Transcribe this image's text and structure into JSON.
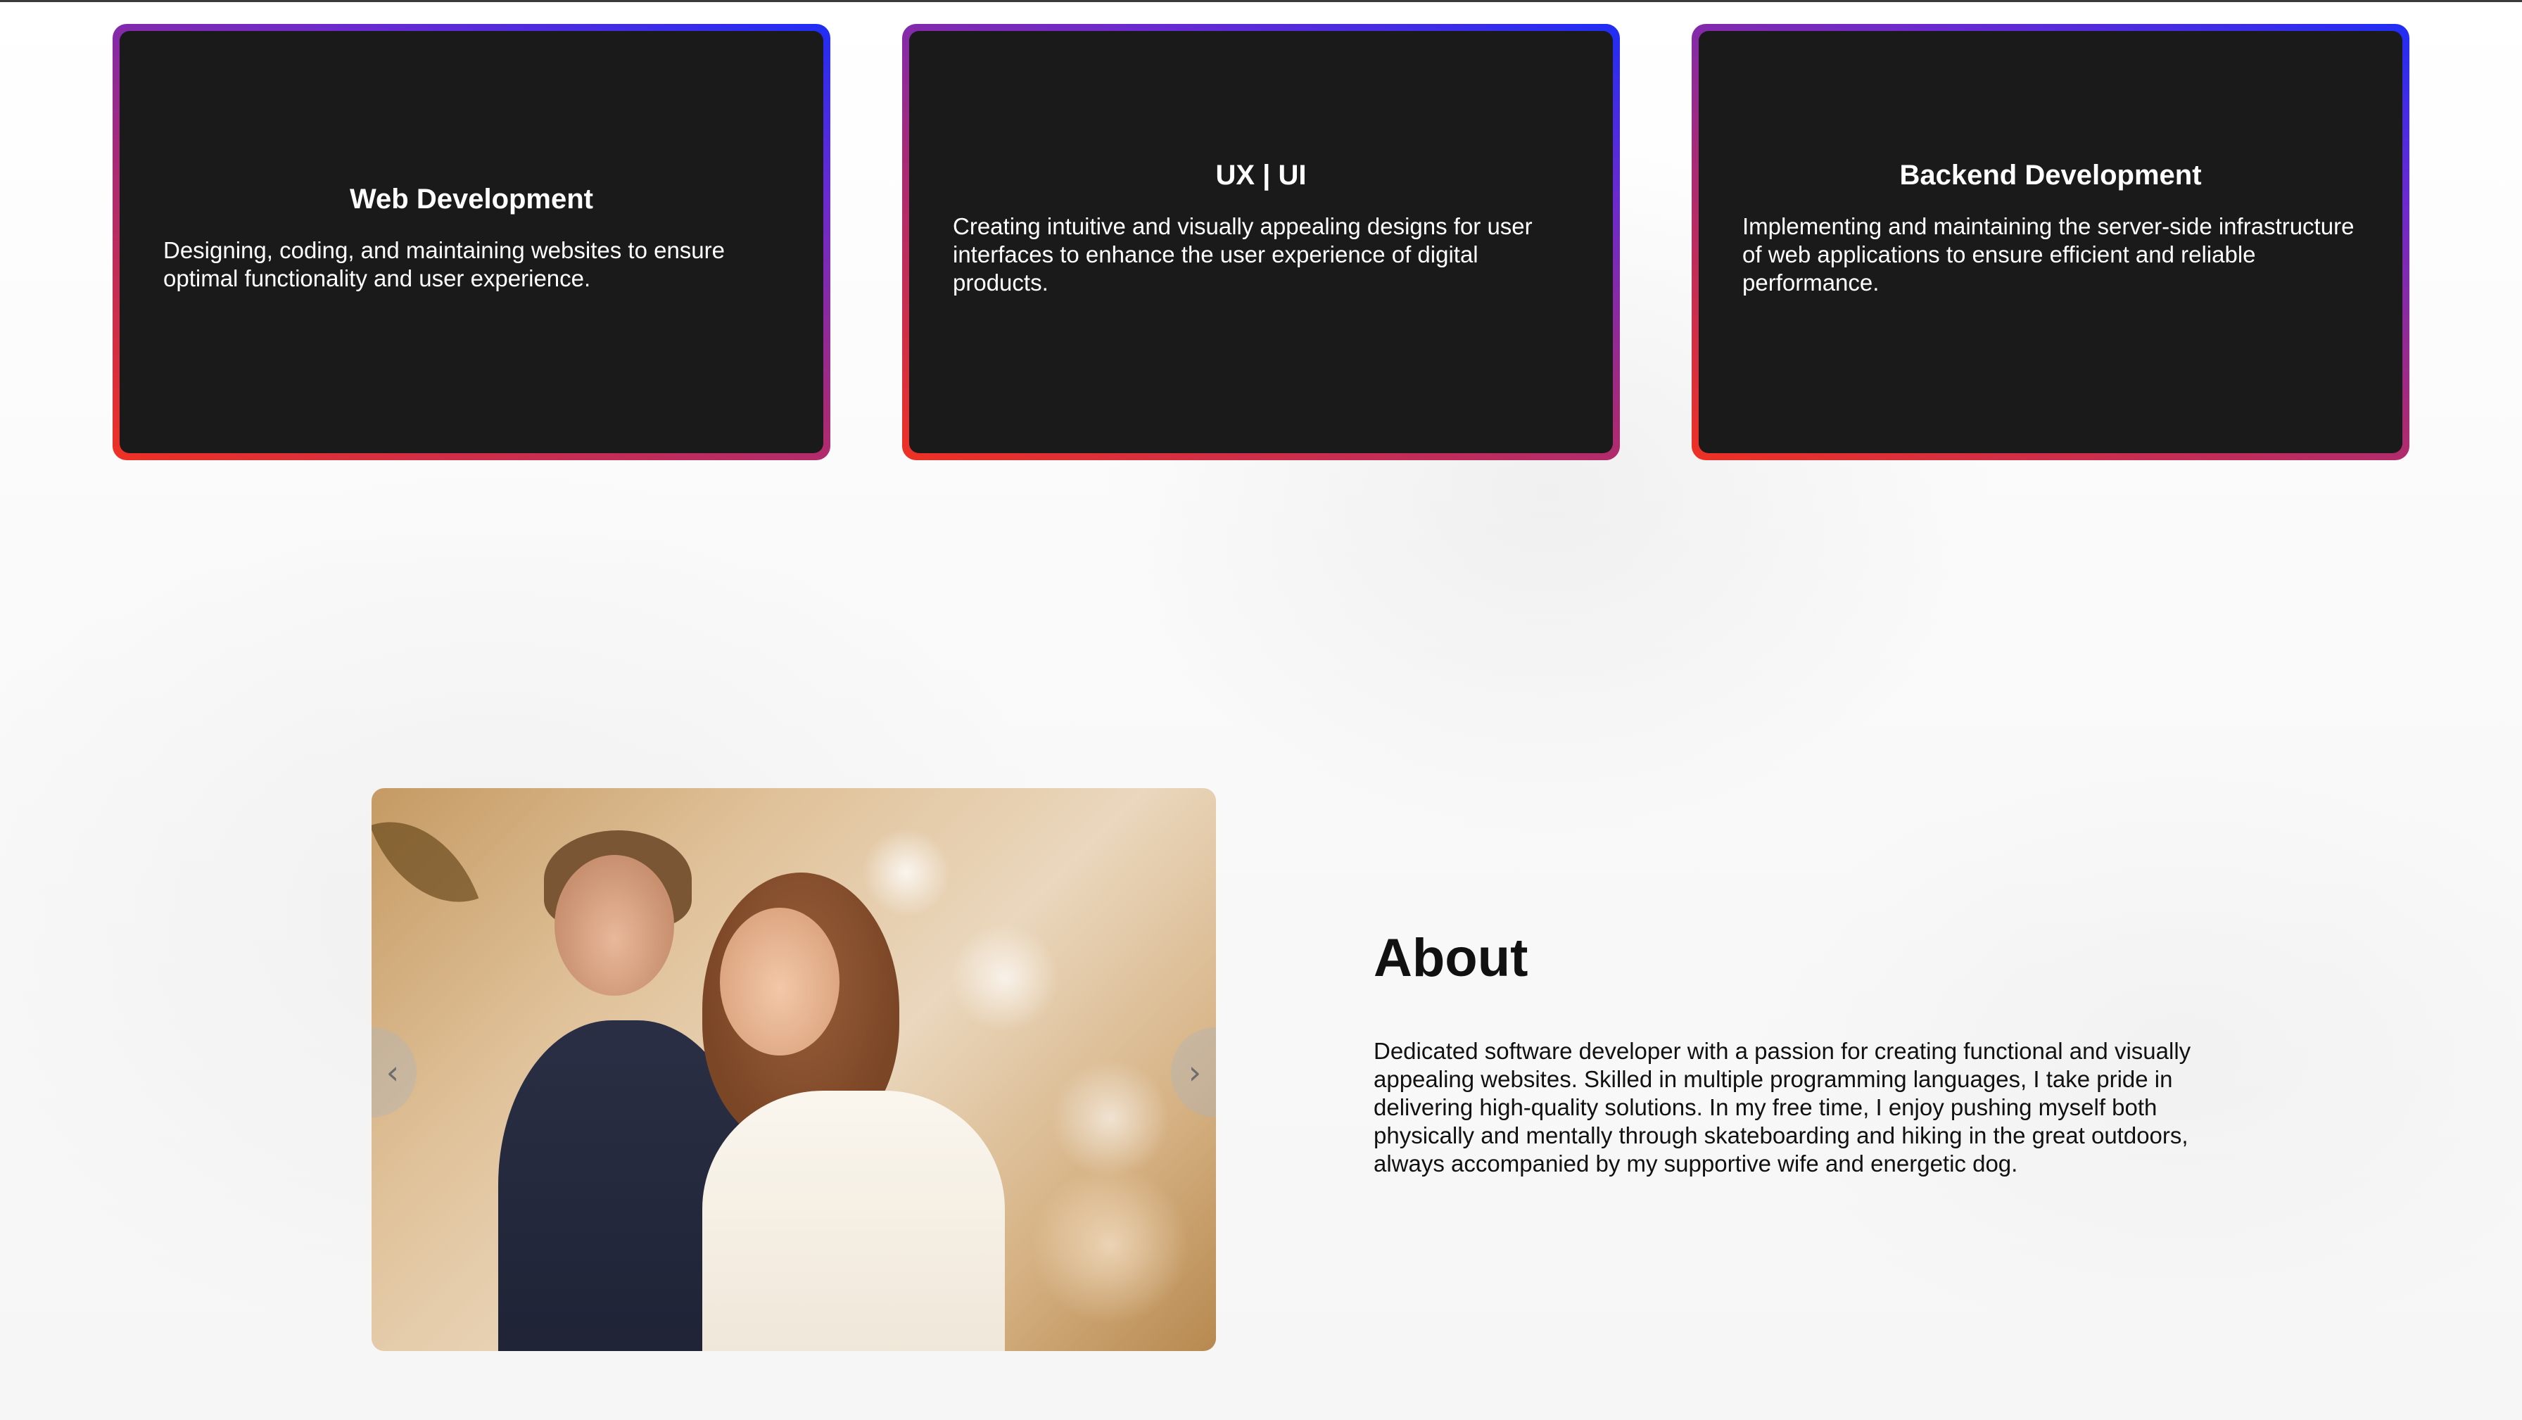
{
  "services": [
    {
      "title": "Web Development",
      "description": "Designing, coding, and maintaining websites to ensure optimal functionality and user experience."
    },
    {
      "title": "UX | UI",
      "description": "Creating intuitive and visually appealing designs for user interfaces to enhance the user experience of digital products."
    },
    {
      "title": "Backend Development",
      "description": "Implementing and maintaining the server-side infrastructure of web applications to ensure efficient and reliable performance."
    }
  ],
  "about": {
    "heading": "About",
    "body": "Dedicated software developer with a passion for creating functional and visually appealing websites. Skilled in multiple programming languages, I take pride in delivering high-quality solutions. In my free time, I enjoy pushing myself both physically and mentally through skateboarding and hiking in the great outdoors, always accompanied by my supportive wife and energetic dog."
  },
  "carousel": {
    "prev_icon": "‹",
    "next_icon": "›"
  },
  "colors": {
    "card_background": "#1a1a1a",
    "card_border_gradient": [
      "#ee3124",
      "#a52a7a",
      "#6a2ad0",
      "#1f2df5"
    ],
    "text": "#111111"
  }
}
